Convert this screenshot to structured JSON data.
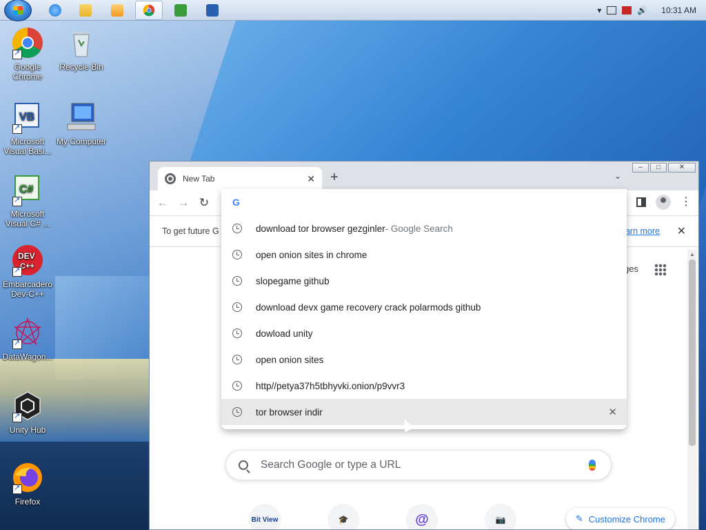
{
  "taskbar": {
    "clock": "10:31 AM",
    "apps": [
      {
        "name": "ie",
        "color": "#1e7ad6"
      },
      {
        "name": "explorer",
        "color": "#e8b52a"
      },
      {
        "name": "media-player",
        "color": "#f09a1c"
      },
      {
        "name": "chrome",
        "color": "#db4437"
      },
      {
        "name": "visual-csharp",
        "color": "#3a9b3a"
      },
      {
        "name": "visual-basic",
        "color": "#2a5fb0"
      }
    ]
  },
  "desktop_icons": [
    {
      "label": "Google Chrome",
      "icon": "chrome-icon"
    },
    {
      "label": "Recycle Bin",
      "icon": "recycle-bin-icon"
    },
    {
      "label": "Microsoft Visual Basi...",
      "icon": "visual-basic-icon"
    },
    {
      "label": "My Computer",
      "icon": "computer-icon"
    },
    {
      "label": "Microsoft Visual C# ...",
      "icon": "visual-csharp-icon"
    },
    {
      "label": "Embarcadero Dev-C++",
      "icon": "dev-cpp-icon"
    },
    {
      "label": "DataWagon...",
      "icon": "datawagon-icon"
    },
    {
      "label": "Unity Hub",
      "icon": "unity-icon"
    },
    {
      "label": "Firefox",
      "icon": "firefox-icon"
    }
  ],
  "chrome": {
    "tab_title": "New Tab",
    "infobar_text": "To get future G",
    "infobar_link": "earn more",
    "images_link": "ges",
    "search_placeholder": "Search Google or type a URL",
    "shortcuts": [
      {
        "label": "Bit View"
      },
      {
        "label": ""
      },
      {
        "label": "@"
      },
      {
        "label": ""
      }
    ],
    "customize_label": "Customize Chrome"
  },
  "omnibox": {
    "suggestions": [
      {
        "text": "download tor browser gezginler",
        "suffix": " - Google Search"
      },
      {
        "text": "open onion sites in chrome",
        "suffix": ""
      },
      {
        "text": "slopegame github",
        "suffix": ""
      },
      {
        "text": "download devx game recovery crack polarmods github",
        "suffix": ""
      },
      {
        "text": "dowload unity",
        "suffix": ""
      },
      {
        "text": "open onion sites",
        "suffix": ""
      },
      {
        "text": "http//petya37h5tbhyvki.onion/p9vvr3",
        "suffix": ""
      },
      {
        "text": "tor browser indir",
        "suffix": ""
      }
    ],
    "hovered_index": 7
  }
}
